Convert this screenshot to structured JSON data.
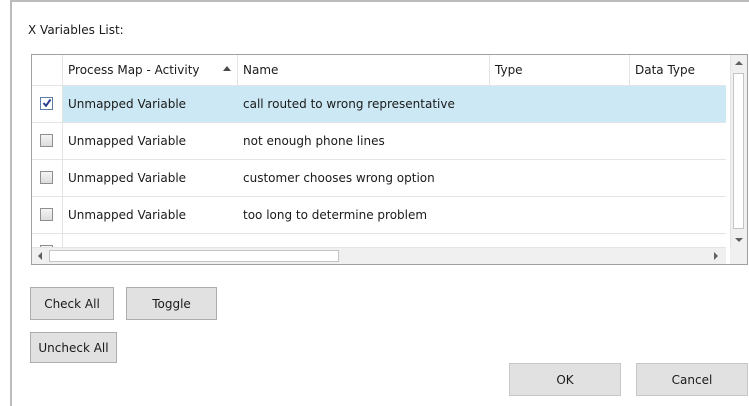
{
  "list_label": "X Variables List:",
  "columns": [
    {
      "label": "Process Map - Activity",
      "sorted": "ascending"
    },
    {
      "label": "Name"
    },
    {
      "label": "Type"
    },
    {
      "label": "Data Type"
    }
  ],
  "rows": [
    {
      "checked": true,
      "activity": "Unmapped Variable",
      "name": "call routed to wrong representative",
      "type": "",
      "data_type": ""
    },
    {
      "checked": false,
      "activity": "Unmapped Variable",
      "name": "not enough phone lines",
      "type": "",
      "data_type": ""
    },
    {
      "checked": false,
      "activity": "Unmapped Variable",
      "name": "customer chooses wrong option",
      "type": "",
      "data_type": ""
    },
    {
      "checked": false,
      "activity": "Unmapped Variable",
      "name": "too long to determine problem",
      "type": "",
      "data_type": ""
    }
  ],
  "buttons": {
    "check_all": "Check All",
    "toggle": "Toggle",
    "uncheck_all": "Uncheck All",
    "ok": "OK",
    "cancel": "Cancel"
  },
  "colors": {
    "selected_row": "#cce8f4",
    "button_face": "#e1e1e1"
  }
}
